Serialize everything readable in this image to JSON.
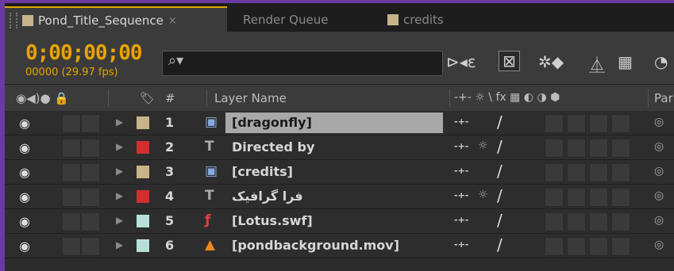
{
  "tabs": [
    {
      "label": "Pond_Title_Sequence",
      "active": true,
      "close": "×",
      "color": "#c8b48a"
    },
    {
      "label": "Render Queue",
      "active": false
    },
    {
      "label": "credits",
      "active": false,
      "color": "#c8b48a"
    }
  ],
  "timecode": "0;00;00;00",
  "frame_info": "00000 (29.97 fps)",
  "search": {
    "placeholder": "",
    "icon": "search-icon"
  },
  "toolbar_icons": [
    "composition-mini-flowchart-icon",
    "draft-3d-icon",
    "hide-shy-layers-icon",
    "frame-blending-icon",
    "motion-blur-icon",
    "graph-editor-icon"
  ],
  "header": {
    "layer_name": "Layer Name",
    "number": "#",
    "parent": "Par",
    "switches_label": "-+- ☼ \\ fx ▦ ◐ ◑ ⬢"
  },
  "layers": [
    {
      "num": "1",
      "name": "[dragonfly]",
      "type": "composition",
      "label_color": "#c8b48a",
      "selected": true
    },
    {
      "num": "2",
      "name": "Directed by",
      "type": "text",
      "label_color": "#d03030",
      "selected": false
    },
    {
      "num": "3",
      "name": "[credits]",
      "type": "composition",
      "label_color": "#c8b48a",
      "selected": false
    },
    {
      "num": "4",
      "name": "فرا گرافیک",
      "type": "text",
      "label_color": "#d03030",
      "selected": false
    },
    {
      "num": "5",
      "name": "[Lotus.swf]",
      "type": "flash",
      "label_color": "#b8e0d8",
      "selected": false
    },
    {
      "num": "6",
      "name": "[pondbackground.mov]",
      "type": "video",
      "label_color": "#b8e0d8",
      "selected": false
    }
  ],
  "colors": {
    "accent": "#e8a400",
    "background": "#2c2c2c",
    "frame": "#6a3aa0"
  }
}
